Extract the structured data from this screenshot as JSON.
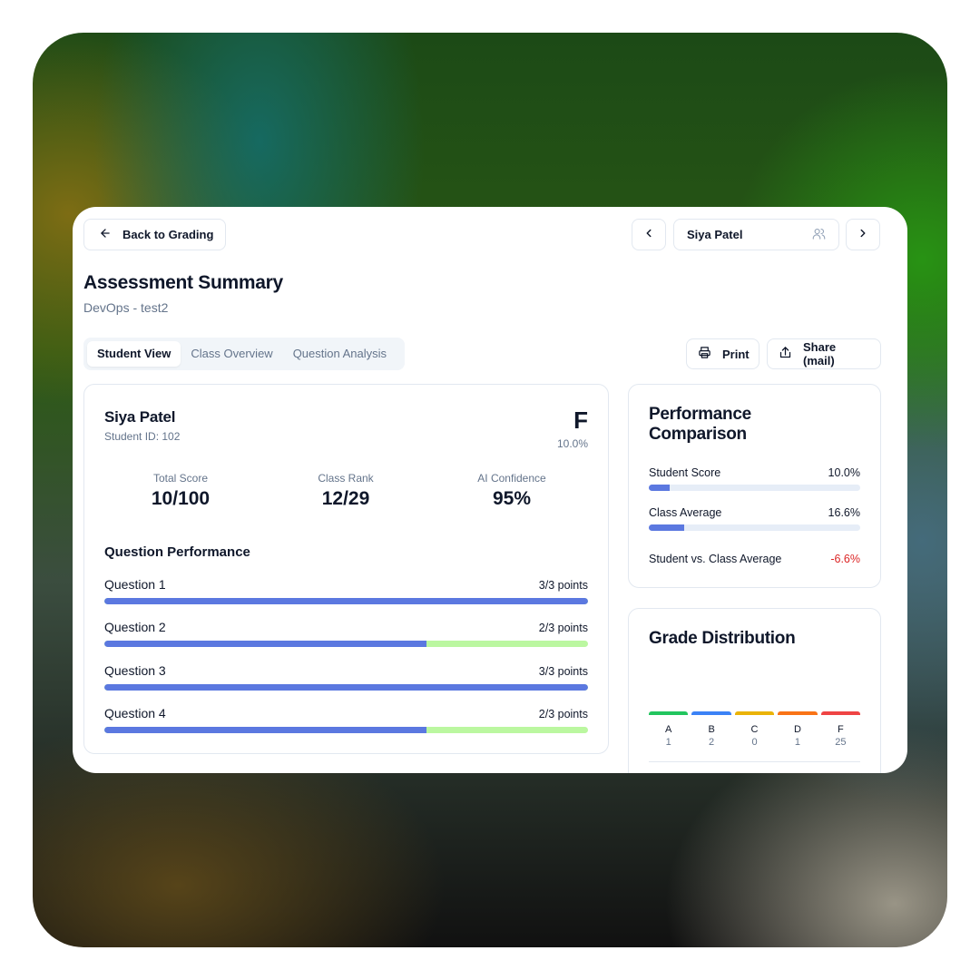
{
  "header": {
    "back_label": "Back to Grading",
    "student_selected": "Siya Patel"
  },
  "page": {
    "title": "Assessment Summary",
    "subtitle": "DevOps - test2"
  },
  "tabs": [
    {
      "label": "Student View",
      "active": true
    },
    {
      "label": "Class Overview",
      "active": false
    },
    {
      "label": "Question Analysis",
      "active": false
    }
  ],
  "actions": {
    "print_label": "Print",
    "share_label": "Share (mail)"
  },
  "student": {
    "name": "Siya Patel",
    "id_text": "Student ID: 102",
    "letter_grade": "F",
    "percent": "10.0%"
  },
  "stats": [
    {
      "label": "Total Score",
      "value": "10/100"
    },
    {
      "label": "Class Rank",
      "value": "12/29"
    },
    {
      "label": "AI Confidence",
      "value": "95%"
    }
  ],
  "question_performance": {
    "title": "Question Performance",
    "questions": [
      {
        "label": "Question 1",
        "points": "3/3 points",
        "fraction": 1.0
      },
      {
        "label": "Question 2",
        "points": "2/3 points",
        "fraction": 0.6667
      },
      {
        "label": "Question 3",
        "points": "3/3 points",
        "fraction": 1.0
      },
      {
        "label": "Question 4",
        "points": "2/3 points",
        "fraction": 0.6667
      }
    ]
  },
  "performance_comparison": {
    "title": "Performance Comparison",
    "rows": [
      {
        "label": "Student Score",
        "value": "10.0%",
        "fraction": 0.1
      },
      {
        "label": "Class Average",
        "value": "16.6%",
        "fraction": 0.166
      }
    ],
    "diff_label": "Student vs. Class Average",
    "diff_value": "-6.6%"
  },
  "grade_distribution": {
    "title": "Grade Distribution",
    "grades": [
      {
        "letter": "A",
        "count": "1",
        "color": "#22c55e"
      },
      {
        "letter": "B",
        "count": "2",
        "color": "#3b82f6"
      },
      {
        "letter": "C",
        "count": "0",
        "color": "#eab308"
      },
      {
        "letter": "D",
        "count": "1",
        "color": "#f97316"
      },
      {
        "letter": "F",
        "count": "25",
        "color": "#ef4444"
      }
    ]
  },
  "colors": {
    "accent": "#5b78e0",
    "remaining": "#bbf7a0",
    "negative": "#dc2626"
  }
}
